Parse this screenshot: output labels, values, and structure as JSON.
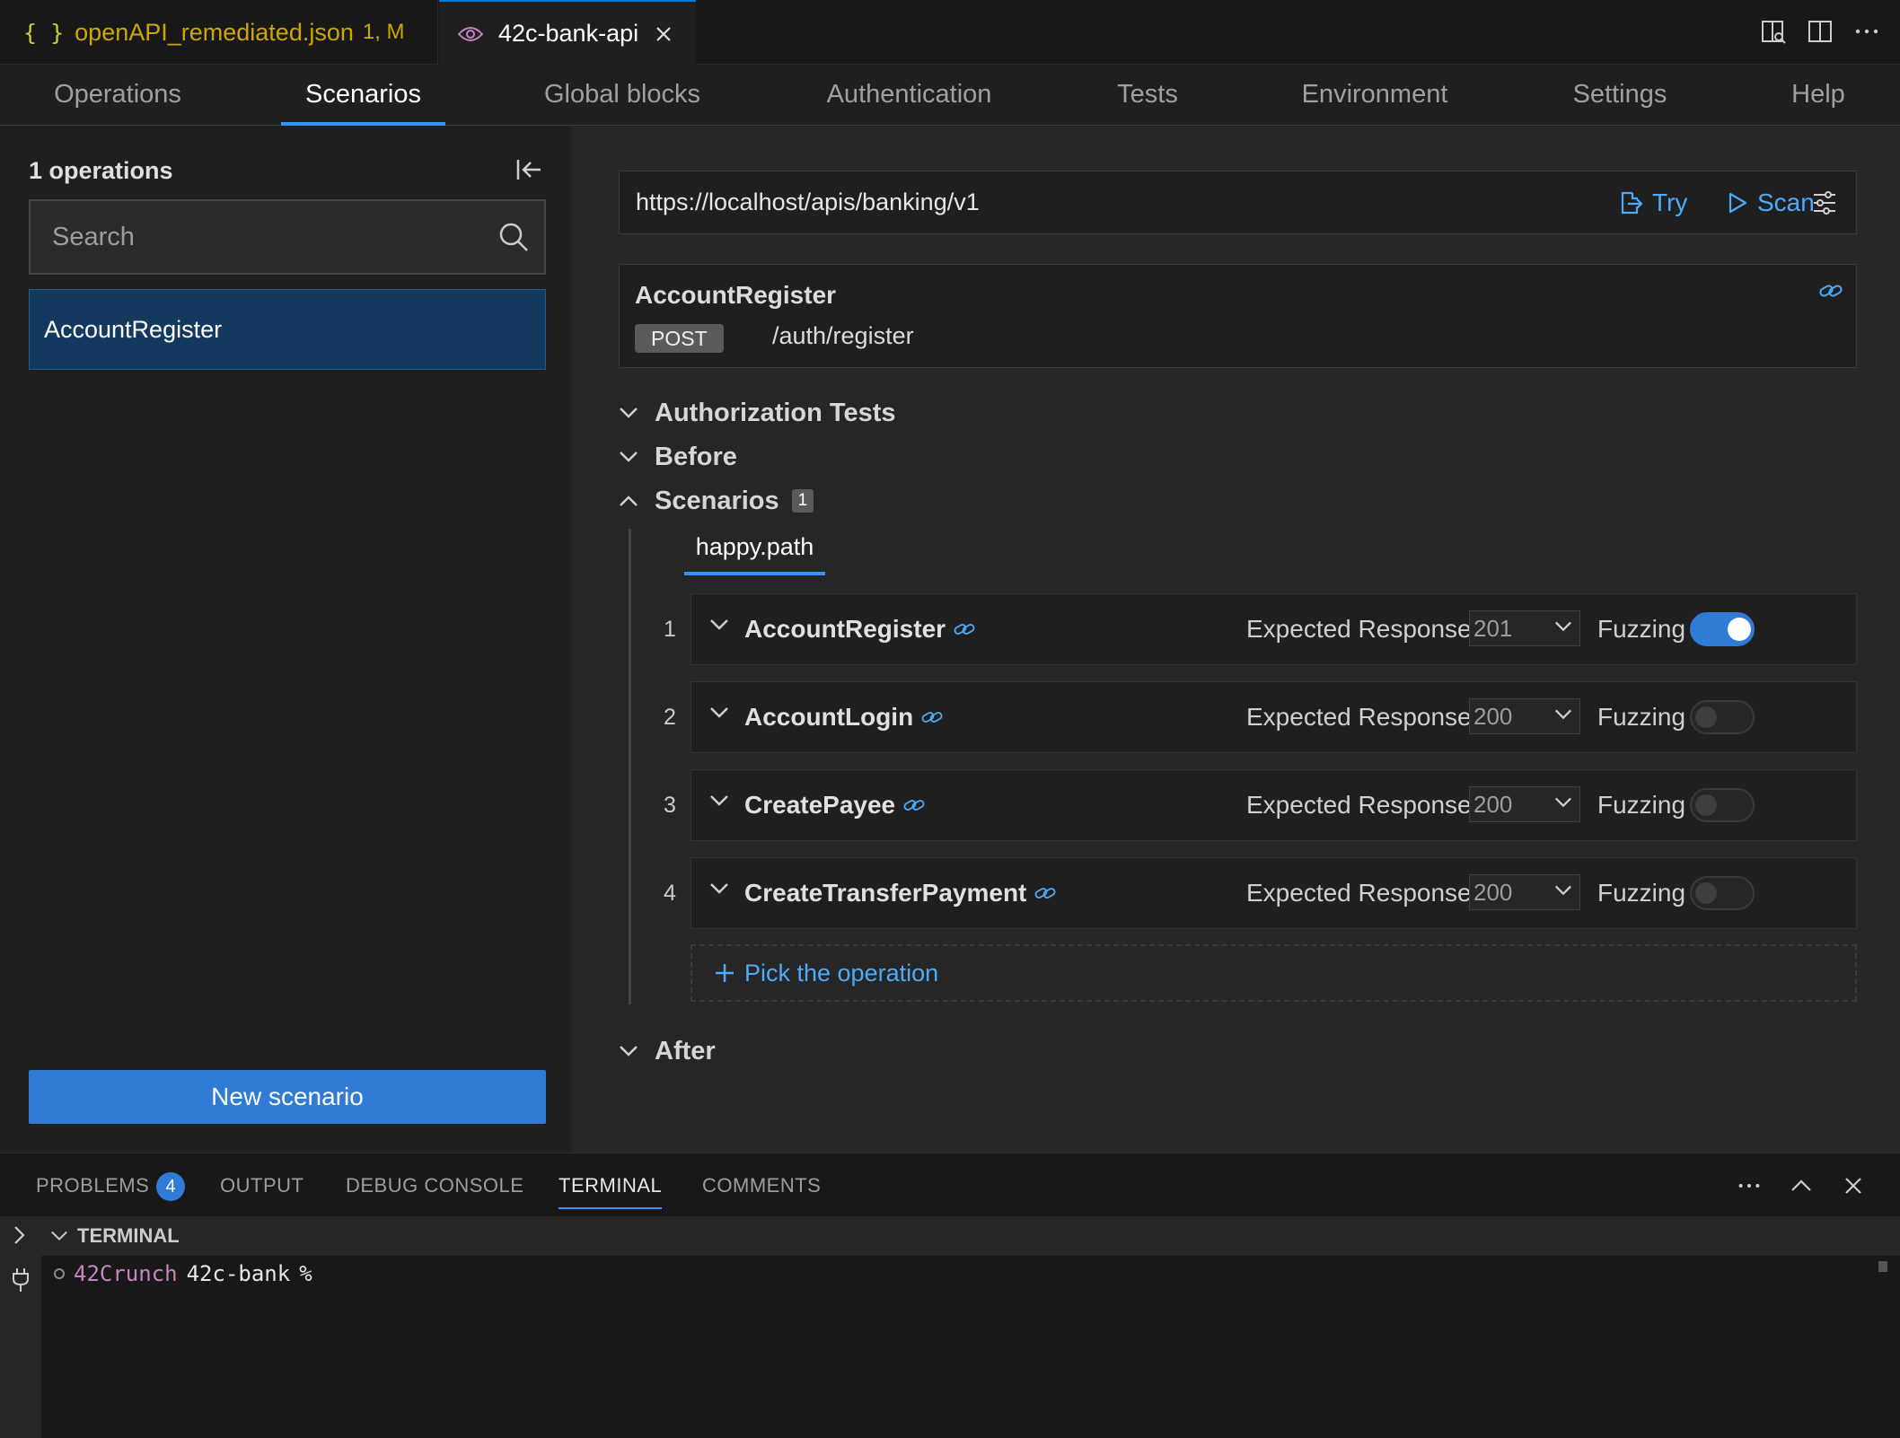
{
  "editor_tabs": [
    {
      "label": "openAPI_remediated.json",
      "badge": "1, M",
      "icon": "json-braces-icon"
    },
    {
      "label": "42c-bank-api",
      "icon": "eye-icon",
      "active": true
    }
  ],
  "json_icon_text": "{ }",
  "nav_tabs": [
    {
      "label": "Operations"
    },
    {
      "label": "Scenarios",
      "active": true
    },
    {
      "label": "Global blocks"
    },
    {
      "label": "Authentication"
    },
    {
      "label": "Tests"
    },
    {
      "label": "Environment"
    },
    {
      "label": "Settings"
    },
    {
      "label": "Help"
    }
  ],
  "sidebar": {
    "operations_count": "1 operations",
    "search_placeholder": "Search",
    "items": [
      {
        "label": "AccountRegister",
        "selected": true
      }
    ],
    "new_scenario_label": "New scenario"
  },
  "main": {
    "url": "https://localhost/apis/banking/v1",
    "try_label": "Try",
    "scan_label": "Scan",
    "operation": {
      "title": "AccountRegister",
      "method": "POST",
      "path": "/auth/register"
    },
    "sections": {
      "authorization_tests": "Authorization Tests",
      "before": "Before",
      "scenarios": "Scenarios",
      "scenarios_count": "1",
      "after": "After"
    },
    "scenario_tab": "happy.path",
    "expected_response_label": "Expected Response",
    "fuzzing_label": "Fuzzing",
    "steps": [
      {
        "num": "1",
        "name": "AccountRegister",
        "expected": "201",
        "fuzzing": true
      },
      {
        "num": "2",
        "name": "AccountLogin",
        "expected": "200",
        "fuzzing": false
      },
      {
        "num": "3",
        "name": "CreatePayee",
        "expected": "200",
        "fuzzing": false
      },
      {
        "num": "4",
        "name": "CreateTransferPayment",
        "expected": "200",
        "fuzzing": false
      }
    ],
    "pick_operation_label": "Pick the operation"
  },
  "panel": {
    "tabs": [
      {
        "label": "PROBLEMS",
        "badge": "4"
      },
      {
        "label": "OUTPUT"
      },
      {
        "label": "DEBUG CONSOLE"
      },
      {
        "label": "TERMINAL",
        "active": true
      },
      {
        "label": "COMMENTS"
      }
    ],
    "terminal_title": "TERMINAL",
    "prompt_user": "42Crunch",
    "prompt_dir": "42c-bank",
    "prompt_symbol": "%"
  },
  "colors": {
    "accent": "#3794ff",
    "button": "#2f7bd6",
    "selected_item": "#133a5e",
    "link": "#4daafc",
    "modified_tab": "#cca700",
    "prompt_user": "#c586c0"
  }
}
